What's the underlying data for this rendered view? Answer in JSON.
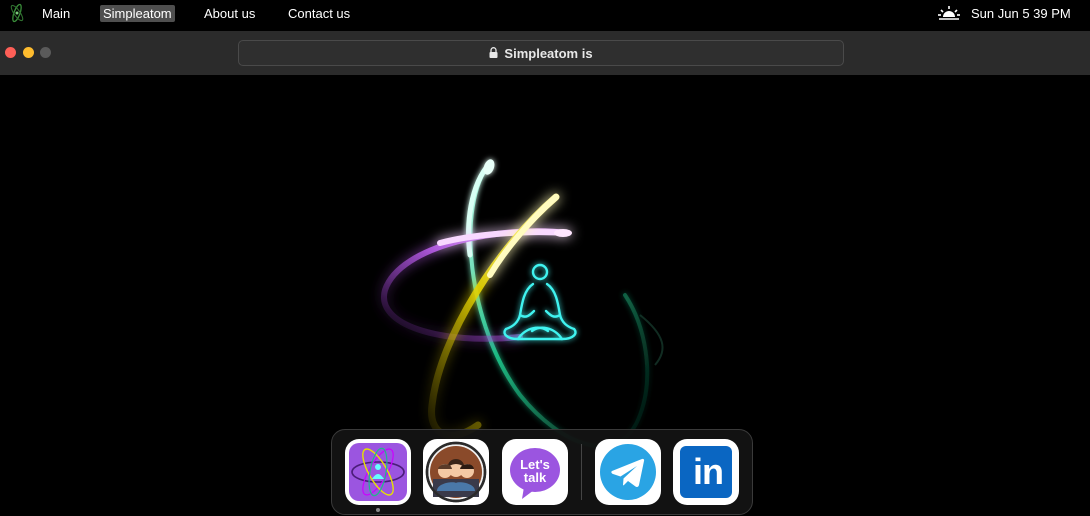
{
  "menubar": {
    "items": [
      {
        "label": "Main"
      },
      {
        "label": "Simpleatom"
      },
      {
        "label": "About us"
      },
      {
        "label": "Contact us"
      }
    ],
    "active_item": "Simpleatom",
    "weather_icon": "sunrise-icon",
    "clock": "Sun Jun 5  39 PM"
  },
  "browser": {
    "url_text": "Simpleatom is",
    "lock_icon": "lock-icon"
  },
  "hero": {
    "center_icon": "meditation-figure-icon",
    "orbit_colors": {
      "purple": "#c77dff",
      "yellow": "#f2e600",
      "green": "#19c98a",
      "figure": "#3ff3f0"
    }
  },
  "dock": {
    "apps": [
      {
        "name": "Simpleatom",
        "icon": "atom-app-icon"
      },
      {
        "name": "About us",
        "icon": "team-app-icon"
      },
      {
        "name": "Let's talk",
        "icon": "lets-talk-app-icon",
        "text_line1": "Let's",
        "text_line2": "talk"
      },
      {
        "name": "Telegram",
        "icon": "telegram-app-icon"
      },
      {
        "name": "LinkedIn",
        "icon": "linkedin-app-icon",
        "text": "in"
      }
    ]
  }
}
